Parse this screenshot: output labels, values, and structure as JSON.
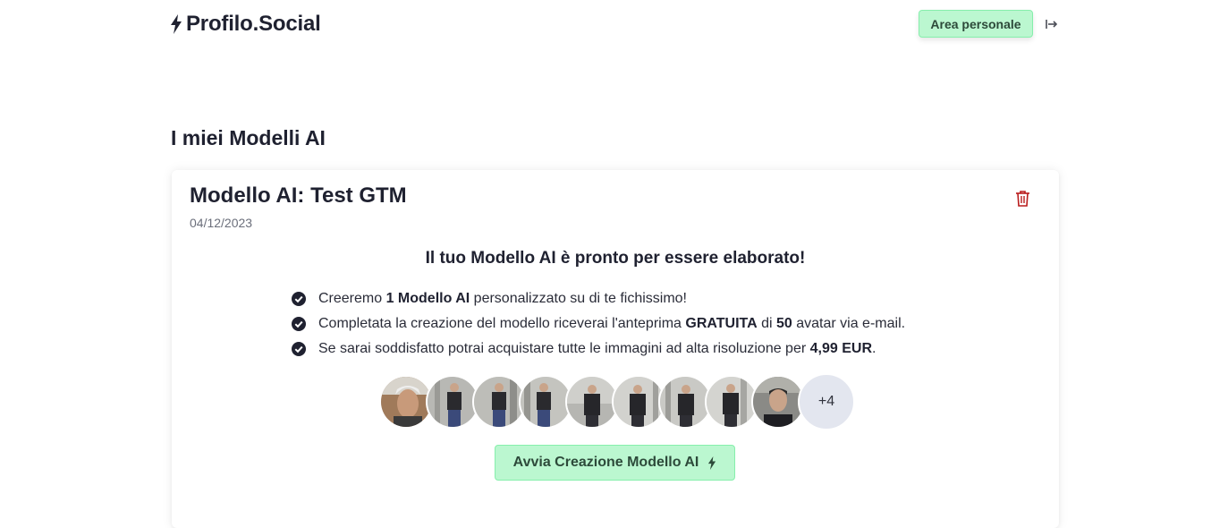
{
  "header": {
    "brand": "Profilo.Social",
    "area_button": "Area personale"
  },
  "page_title": "I miei Modelli AI",
  "model": {
    "title": "Modello AI: Test GTM",
    "date": "04/12/2023",
    "ready_message": "Il tuo Modello AI è pronto per essere elaborato!",
    "bullets": [
      {
        "pre": "Creeremo ",
        "bold": "1 Modello AI",
        "post": " personalizzato su di te fichissimo!"
      },
      {
        "pre": "Completata la creazione del modello riceverai l'anteprima ",
        "bold": "GRATUITA",
        "mid": " di ",
        "bold2": "50",
        "post": " avatar via e-mail."
      },
      {
        "pre": "Se sarai soddisfatto potrai acquistare tutte le immagini ad alta risoluzione per ",
        "bold": "4,99 EUR",
        "post": "."
      }
    ],
    "more_photos": "+4",
    "start_button": "Avvia Creazione Modello AI"
  },
  "colors": {
    "accent_bg": "#bbf7d0",
    "accent_border": "#86efac",
    "danger": "#b91c1c"
  },
  "icons": [
    "bolt-icon",
    "logout-icon",
    "trash-icon",
    "check-circle-icon"
  ]
}
